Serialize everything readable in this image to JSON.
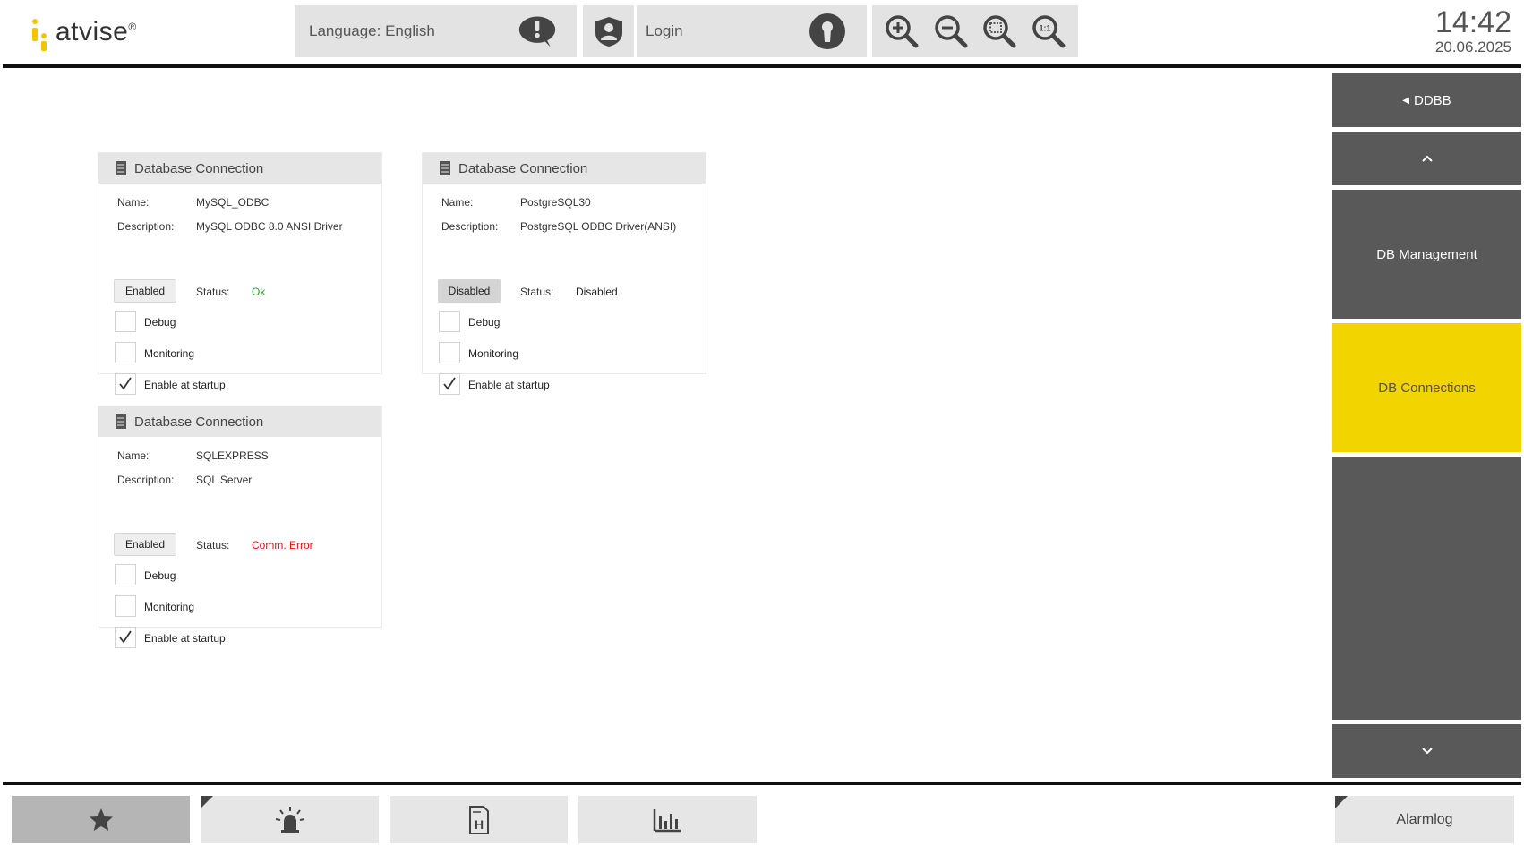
{
  "header": {
    "logo_text": "atvise",
    "logo_reg": "®",
    "language_label": "Language: English",
    "login_label": "Login",
    "zoom_buttons": [
      {
        "icon": "zoom-in-icon"
      },
      {
        "icon": "zoom-out-icon"
      },
      {
        "icon": "zoom-fit-icon"
      },
      {
        "icon": "zoom-reset-icon",
        "label": "1:1"
      }
    ],
    "time": "14:42",
    "date": "20.06.2025"
  },
  "sidebar": {
    "back_label": "DDBB",
    "items": [
      {
        "label": "DB Management",
        "active": false
      },
      {
        "label": "DB Connections",
        "active": true
      },
      {
        "label": "",
        "active": false
      }
    ]
  },
  "labels": {
    "card_title": "Database Connection",
    "name": "Name:",
    "description": "Description:",
    "status": "Status:",
    "debug": "Debug",
    "monitoring": "Monitoring",
    "enable_startup": "Enable at startup"
  },
  "connections": [
    {
      "name": "MySQL_ODBC",
      "description": "MySQL ODBC 8.0 ANSI Driver",
      "toggle": "Enabled",
      "status": "Ok",
      "status_color": "#2e9c2e",
      "debug": false,
      "monitoring": false,
      "startup": true
    },
    {
      "name": "PostgreSQL30",
      "description": "PostgreSQL ODBC Driver(ANSI)",
      "toggle": "Disabled",
      "status": "Disabled",
      "status_color": "#222222",
      "debug": false,
      "monitoring": false,
      "startup": true
    },
    {
      "name": "SQLEXPRESS",
      "description": "SQL Server",
      "toggle": "Enabled",
      "status": "Comm. Error",
      "status_color": "#e01010",
      "debug": false,
      "monitoring": false,
      "startup": true
    }
  ],
  "footer": {
    "buttons": [
      {
        "icon": "star-icon"
      },
      {
        "icon": "alarm-light-icon"
      },
      {
        "icon": "document-h-icon",
        "label": "H"
      },
      {
        "icon": "bar-chart-icon"
      }
    ],
    "alarmlog_label": "Alarmlog"
  },
  "colors": {
    "accent": "#f2d400",
    "nav": "#595959",
    "ok": "#2e9c2e",
    "error": "#e01010"
  }
}
